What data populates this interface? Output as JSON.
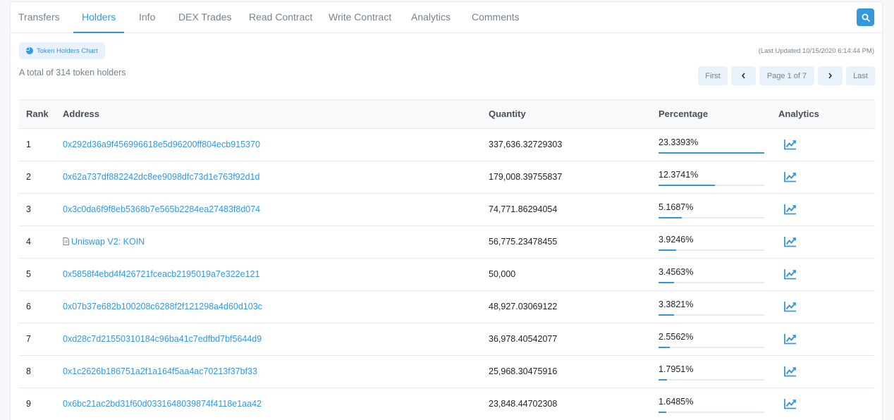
{
  "tabs": [
    {
      "label": "Transfers"
    },
    {
      "label": "Holders"
    },
    {
      "label": "Info"
    },
    {
      "label": "DEX Trades"
    },
    {
      "label": "Read Contract"
    },
    {
      "label": "Write Contract"
    },
    {
      "label": "Analytics"
    },
    {
      "label": "Comments"
    }
  ],
  "active_tab": "Holders",
  "chart_button_label": "Token Holders Chart",
  "last_updated": "(Last Updated 10/15/2020 6:14:44 PM)",
  "total_text": "A total of 314 token holders",
  "pagination": {
    "first": "First",
    "page": "Page 1 of 7",
    "last": "Last"
  },
  "table": {
    "headers": {
      "rank": "Rank",
      "address": "Address",
      "quantity": "Quantity",
      "percentage": "Percentage",
      "analytics": "Analytics"
    },
    "rows": [
      {
        "rank": "1",
        "address": "0x292d36a9f456996618e5d96200ff804ecb915370",
        "quantity": "337,636.32729303",
        "percentage": "23.3393%",
        "pct_value": 23.3393,
        "is_contract": false
      },
      {
        "rank": "2",
        "address": "0x62a737df882242dc8ee9098dfc73d1e763f92d1d",
        "quantity": "179,008.39755837",
        "percentage": "12.3741%",
        "pct_value": 12.3741,
        "is_contract": false
      },
      {
        "rank": "3",
        "address": "0x3c0da6f9f8eb5368b7e565b2284ea27483f8d074",
        "quantity": "74,771.86294054",
        "percentage": "5.1687%",
        "pct_value": 5.1687,
        "is_contract": false
      },
      {
        "rank": "4",
        "address": "Uniswap V2: KOIN",
        "quantity": "56,775.23478455",
        "percentage": "3.9246%",
        "pct_value": 3.9246,
        "is_contract": true
      },
      {
        "rank": "5",
        "address": "0x5858f4ebd4f426721fceacb2195019a7e322e121",
        "quantity": "50,000",
        "percentage": "3.4563%",
        "pct_value": 3.4563,
        "is_contract": false
      },
      {
        "rank": "6",
        "address": "0x07b37e682b100208c6288f2f121298a4d60d103c",
        "quantity": "48,927.03069122",
        "percentage": "3.3821%",
        "pct_value": 3.3821,
        "is_contract": false
      },
      {
        "rank": "7",
        "address": "0xd28c7d21550310184c96ba41c7edfbd7bf5644d9",
        "quantity": "36,978.40542077",
        "percentage": "2.5562%",
        "pct_value": 2.5562,
        "is_contract": false
      },
      {
        "rank": "8",
        "address": "0x1c2626b186751a2f1a164f5aa4ac70213f37bf33",
        "quantity": "25,968.30475916",
        "percentage": "1.7951%",
        "pct_value": 1.7951,
        "is_contract": false
      },
      {
        "rank": "9",
        "address": "0x6bc21ac2bd31f60d0331648039874f4118e1aa42",
        "quantity": "23,848.44702308",
        "percentage": "1.6485%",
        "pct_value": 1.6485,
        "is_contract": false
      }
    ]
  },
  "colors": {
    "accent": "#3498db",
    "text": "#1e2022",
    "muted": "#77838f",
    "border": "#e7eaf3"
  },
  "icons": {
    "search": "search-icon",
    "chart": "pie-chart-icon",
    "prev": "chevron-left-icon",
    "next": "chevron-right-icon",
    "analytics": "line-chart-icon",
    "contract": "document-icon"
  }
}
